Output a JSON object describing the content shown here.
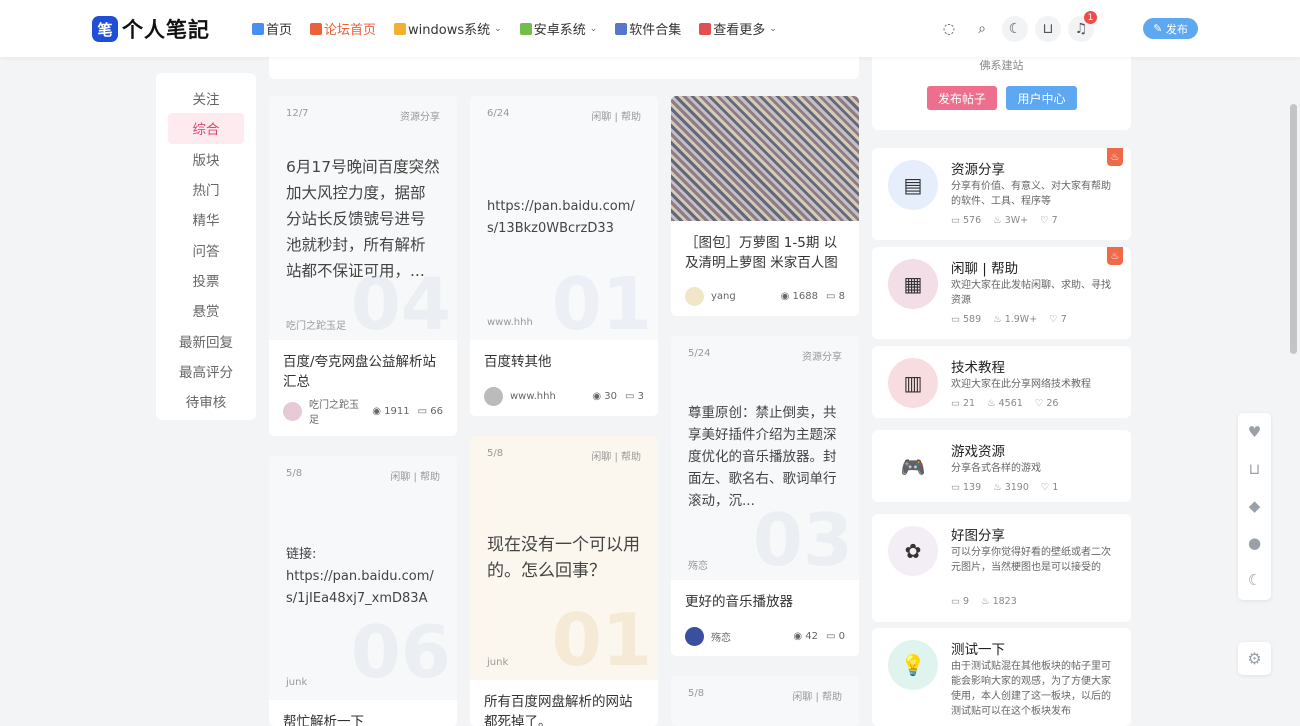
{
  "logo": {
    "mark": "笔",
    "text": "个人笔記"
  },
  "nav": [
    {
      "label": "首页",
      "color": "#4a8ef0",
      "chevron": false,
      "active": false
    },
    {
      "label": "论坛首页",
      "color": "#e8623c",
      "chevron": false,
      "active": true
    },
    {
      "label": "windows系统",
      "color": "#f0b030",
      "chevron": true,
      "active": false
    },
    {
      "label": "安卓系统",
      "color": "#6fbf4a",
      "chevron": true,
      "active": false
    },
    {
      "label": "软件合集",
      "color": "#5577cc",
      "chevron": false,
      "active": false
    },
    {
      "label": "查看更多",
      "color": "#e05050",
      "chevron": true,
      "active": false
    }
  ],
  "header_icons": {
    "notification_count": "1"
  },
  "publish_label": "发布",
  "left_menu": [
    {
      "label": "关注",
      "active": false
    },
    {
      "label": "综合",
      "active": true
    },
    {
      "label": "版块",
      "active": false
    },
    {
      "label": "热门",
      "active": false
    },
    {
      "label": "精华",
      "active": false
    },
    {
      "label": "问答",
      "active": false
    },
    {
      "label": "投票",
      "active": false
    },
    {
      "label": "悬赏",
      "active": false
    },
    {
      "label": "最新回复",
      "active": false
    },
    {
      "label": "最高评分",
      "active": false
    },
    {
      "label": "待审核",
      "active": false
    }
  ],
  "posts": [
    {
      "date": "12/7",
      "category": "资源分享",
      "body": "6月17号晚间百度突然加大风控力度，据部分站长反馈號号进号池就秒封，所有解析站都不保证可用，...",
      "author_line": "吃门之跎玉足",
      "num": "04",
      "title": "百度/夸克网盘公益解析站汇总",
      "author": "吃门之跎玉足",
      "views": "1911",
      "comments": "66"
    },
    {
      "date": "6/24",
      "category": "闲聊 | 帮助",
      "body": "https://pan.baidu.com/s/13Bkz0WBcrzD33Q?...",
      "author_line": "www.hhh",
      "num": "01",
      "title": "百度转其他",
      "author": "www.hhh",
      "views": "30",
      "comments": "3"
    },
    {
      "title": "［图包］万萝图 1-5期 以及清明上萝图 米家百人图 ...",
      "author": "yang",
      "views": "1688",
      "comments": "8"
    },
    {
      "date": "5/8",
      "category": "闲聊 | 帮助",
      "body": "链接:\nhttps://pan.baidu.com/s/1jIEa48xj7_xmD83AZ...",
      "author_line": "junk",
      "num": "06",
      "title": "帮忙解析一下"
    },
    {
      "date": "5/8",
      "category": "闲聊 | 帮助",
      "body": "现在没有一个可以用的。怎么回事？",
      "author_line": "junk",
      "num": "01",
      "title": "所有百度网盘解析的网站都死掉了。"
    },
    {
      "date": "5/24",
      "category": "资源分享",
      "body": "尊重原创：禁止倒卖，共享美好插件介绍为主题深度优化的音乐播放器。封面左、歌名右、歌词单行滚动，沉...",
      "author_line": "殇恋",
      "num": "03",
      "title": "更好的音乐播放器",
      "author": "殇恋",
      "views": "42",
      "comments": "0"
    },
    {
      "date": "5/8",
      "category": "闲聊 | 帮助"
    }
  ],
  "side_top": {
    "subtitle": "佛系建站",
    "btn_post": "发布帖子",
    "btn_user": "用户中心"
  },
  "forums": [
    {
      "name": "资源分享",
      "desc": "分享有价值、有意义、对大家有帮助的软件、工具、程序等",
      "comments": "576",
      "heat": "3W+",
      "likes": "7",
      "hot": true,
      "icon_bg": "#e6eefc",
      "icon": "▤"
    },
    {
      "name": "闲聊 | 帮助",
      "desc": "欢迎大家在此发帖闲聊、求助、寻找资源",
      "comments": "589",
      "heat": "1.9W+",
      "likes": "7",
      "hot": true,
      "icon_bg": "#f3dde6",
      "icon": "▦"
    },
    {
      "name": "技术教程",
      "desc": "欢迎大家在此分享网络技术教程",
      "comments": "21",
      "heat": "4561",
      "likes": "26",
      "hot": false,
      "icon_bg": "#f8dde0",
      "icon": "▥"
    },
    {
      "name": "游戏资源",
      "desc": "分享各式各样的游戏",
      "comments": "139",
      "heat": "3190",
      "likes": "1",
      "hot": false,
      "icon_bg": "#ffffff",
      "icon": "🎮"
    },
    {
      "name": "好图分享",
      "desc": "可以分享你觉得好看的壁纸或者二次元图片，当然梗图也是可以接受的",
      "comments": "9",
      "heat": "1823",
      "likes": "",
      "hot": false,
      "icon_bg": "#f3eef6",
      "icon": "✿"
    },
    {
      "name": "测试一下",
      "desc": "由于测试贴混在其他板块的帖子里可能会影响大家的观感，为了方便大家使用，本人创建了这一板块，以后的测试贴可以在这个板块发布",
      "hot": false,
      "icon_bg": "#e0f4ef",
      "icon": "💡"
    }
  ],
  "colors": {
    "accent_pink": "#e0486e",
    "accent_blue": "#5ea8f2",
    "brand": "#1f4fd6"
  }
}
